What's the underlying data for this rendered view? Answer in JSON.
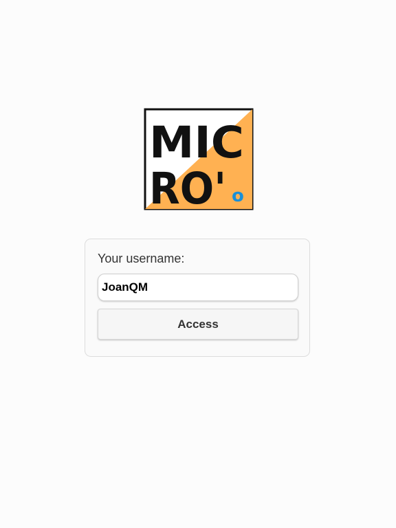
{
  "logo": {
    "line1": "MIC",
    "line2": "RO'",
    "badge": "o",
    "colors": {
      "accent": "#ffb152",
      "border": "#111111",
      "text": "#111111",
      "badge": "#1a8fd8"
    }
  },
  "login": {
    "username_label": "Your username:",
    "username_value": "JoanQM",
    "access_label": "Access"
  }
}
